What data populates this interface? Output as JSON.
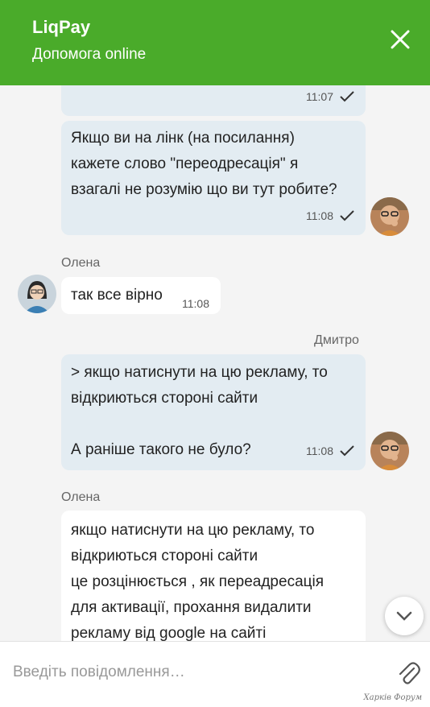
{
  "header": {
    "title": "LiqPay",
    "subtitle": "Допомога online",
    "close_icon": "close-icon",
    "color": "#4aab2a"
  },
  "messages": [
    {
      "direction": "out",
      "text": "",
      "time": "11:07",
      "status_icon": "check-icon"
    },
    {
      "direction": "out",
      "text": "Якщо ви на лінк (на посилання)\nкажете слово \"переодресація\" я\nвзагалі не розумію що ви тут робите?",
      "time": "11:08",
      "status_icon": "check-icon"
    },
    {
      "direction": "in",
      "sender": "Олена",
      "text": "так все вірно",
      "time": "11:08"
    },
    {
      "direction": "out",
      "sender": "Дмитро",
      "text": "> якщо натиснути на цю рекламу, то\nвідкриються стороні сайти\n\nА раніше такого не було?",
      "time": "11:08",
      "status_icon": "check-icon"
    },
    {
      "direction": "in",
      "sender": "Олена",
      "text": "якщо натиснути на цю рекламу, то\nвідкриються стороні сайти\nце розцінюється , як переадресація\nдля активації, прохання видалити\nрекламу від google на сайті"
    }
  ],
  "composer": {
    "placeholder": "Введіть повідомлення…",
    "attach_icon": "paperclip-icon"
  },
  "scroll_button_icon": "chevron-down-icon",
  "watermark": "Харків Форум",
  "colors": {
    "outgoing_bubble": "#e3ecf2",
    "incoming_bubble": "#ffffff",
    "background": "#f4f4f4"
  }
}
